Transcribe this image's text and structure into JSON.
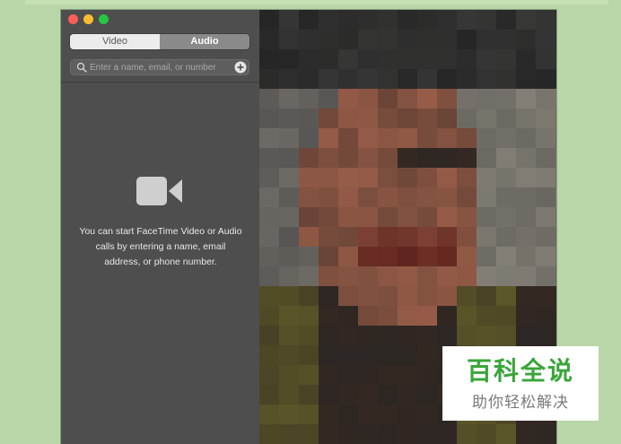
{
  "tabs": [
    {
      "label": "Video",
      "selected": false
    },
    {
      "label": "Audio",
      "selected": true
    }
  ],
  "search": {
    "placeholder": "Enter a name, email, or number",
    "value": ""
  },
  "empty_state": {
    "icon": "video-camera-icon",
    "message": "You can start FaceTime Video or Audio calls by entering a name, email address, or phone number."
  },
  "video_preview": {
    "content": "pixelated-camera-preview"
  },
  "watermark": {
    "title": "百科全说",
    "subtitle": "助你轻松解决"
  },
  "colors": {
    "page_background": "#b9d6a8",
    "sidebar": "#4e4e4e",
    "selected_tab_text": "#ffffff",
    "watermark_green": "#3aa53a"
  }
}
